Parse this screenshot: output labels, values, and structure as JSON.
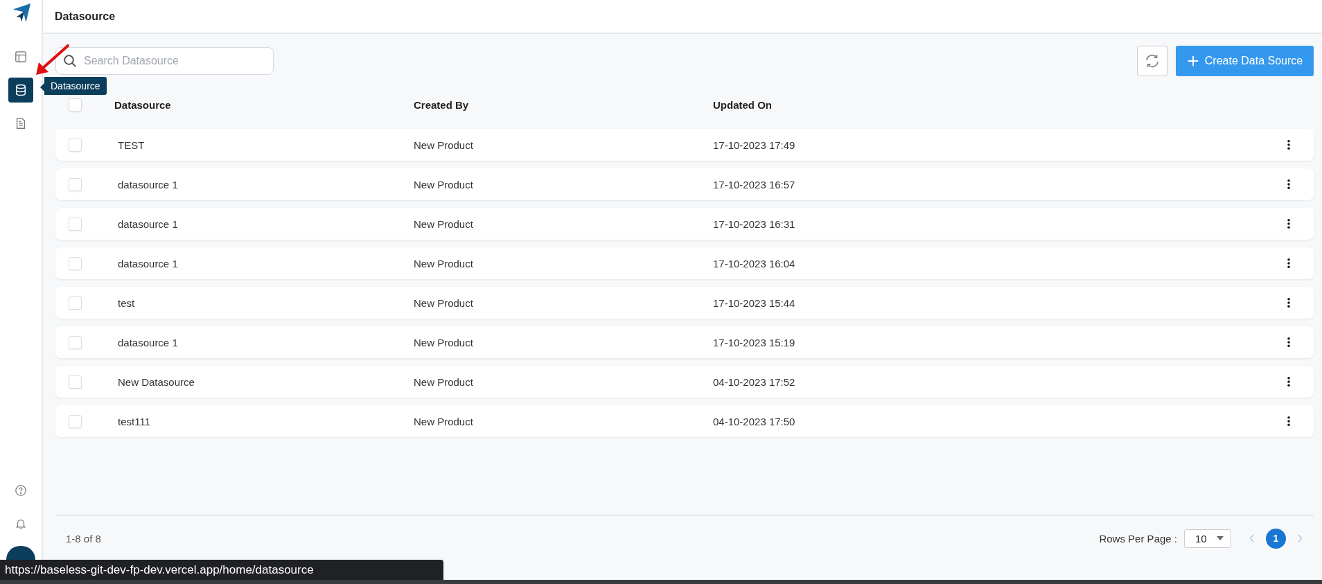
{
  "sidebar": {
    "items": [
      {
        "kind": "layout",
        "selected": false
      },
      {
        "kind": "database",
        "selected": true
      },
      {
        "kind": "document",
        "selected": false
      }
    ],
    "bottom_items": [
      {
        "kind": "help"
      },
      {
        "kind": "bell"
      }
    ]
  },
  "tooltip": "Datasource",
  "header": {
    "title": "Datasource"
  },
  "search": {
    "placeholder": "Search Datasource"
  },
  "create_button": "Create Data Source",
  "table": {
    "columns": [
      "Datasource",
      "Created By",
      "Updated On"
    ],
    "all_checked": false,
    "rows": [
      {
        "name": "TEST",
        "created_by": "New Product",
        "updated_on": "17-10-2023 17:49",
        "checked": false
      },
      {
        "name": "datasource 1",
        "created_by": "New Product",
        "updated_on": "17-10-2023 16:57",
        "checked": false
      },
      {
        "name": "datasource 1",
        "created_by": "New Product",
        "updated_on": "17-10-2023 16:31",
        "checked": false
      },
      {
        "name": "datasource 1",
        "created_by": "New Product",
        "updated_on": "17-10-2023 16:04",
        "checked": false
      },
      {
        "name": "test",
        "created_by": "New Product",
        "updated_on": "17-10-2023 15:44",
        "checked": false
      },
      {
        "name": "datasource 1",
        "created_by": "New Product",
        "updated_on": "17-10-2023 15:19",
        "checked": false
      },
      {
        "name": "New Datasource",
        "created_by": "New Product",
        "updated_on": "04-10-2023 17:52",
        "checked": false
      },
      {
        "name": "test111",
        "created_by": "New Product",
        "updated_on": "04-10-2023 17:50",
        "checked": false
      }
    ]
  },
  "footer": {
    "range": "1-8 of 8",
    "rows_per_page_label": "Rows Per Page :",
    "rows_per_page": "10",
    "pages": [
      {
        "label": "1",
        "selected": true
      }
    ]
  },
  "status_url": "https://baseless-git-dev-fp-dev.vercel.app/home/datasource"
}
